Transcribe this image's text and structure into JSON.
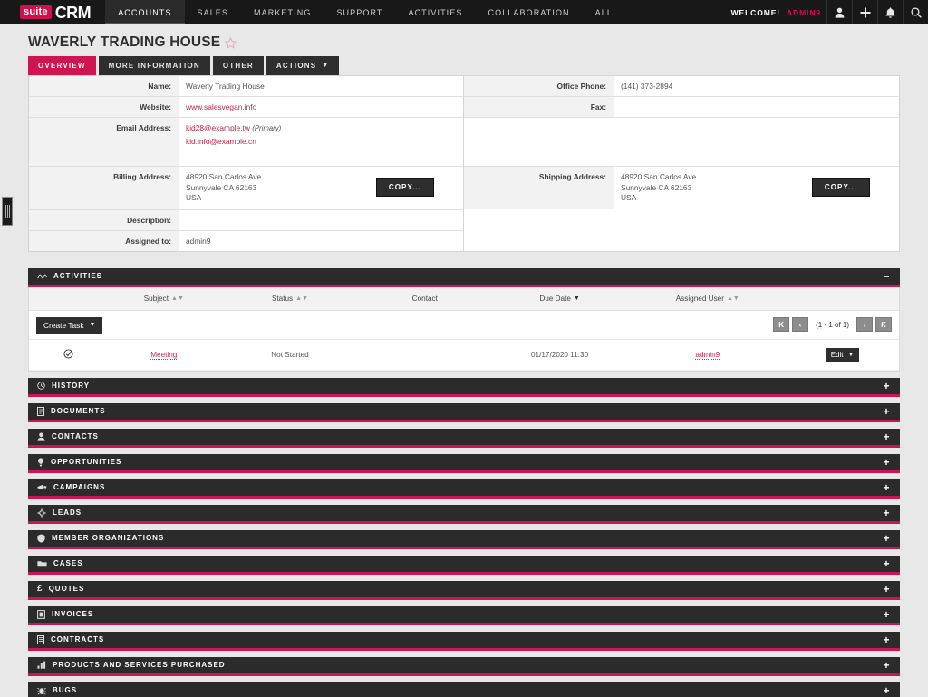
{
  "nav": {
    "logo_suite": "suite",
    "logo_crm": "CRM",
    "items": [
      {
        "label": "ACCOUNTS",
        "active": true
      },
      {
        "label": "SALES",
        "active": false
      },
      {
        "label": "MARKETING",
        "active": false
      },
      {
        "label": "SUPPORT",
        "active": false
      },
      {
        "label": "ACTIVITIES",
        "active": false
      },
      {
        "label": "COLLABORATION",
        "active": false
      },
      {
        "label": "ALL",
        "active": false
      }
    ],
    "welcome_label": "WELCOME!",
    "user_name": "ADMIN9",
    "icons": [
      "user-icon",
      "plus-icon",
      "bell-icon",
      "search-icon"
    ]
  },
  "page": {
    "title": "WAVERLY TRADING HOUSE",
    "favorite_icon": "star-icon"
  },
  "tabs": [
    {
      "label": "OVERVIEW",
      "active": true
    },
    {
      "label": "MORE INFORMATION",
      "active": false
    },
    {
      "label": "OTHER",
      "active": false
    },
    {
      "label": "ACTIONS",
      "active": false,
      "caret": true
    }
  ],
  "detail": {
    "left": [
      {
        "label": "Name:",
        "value": "Waverly Trading House"
      },
      {
        "label": "Website:",
        "value": "www.salesvegan.info",
        "link": true
      },
      {
        "label": "Email Address:",
        "emails": [
          {
            "address": "kid28@example.tw",
            "tag": "(Primary)"
          },
          {
            "address": "kid.info@example.cn",
            "tag": ""
          }
        ]
      },
      {
        "label": "Billing Address:",
        "address": [
          "48920 San Carlos Ave",
          "Sunnyvale CA   62163",
          "USA"
        ],
        "copy_label": "COPY..."
      },
      {
        "label": "Description:",
        "value": ""
      },
      {
        "label": "Assigned to:",
        "value": "admin9"
      }
    ],
    "right": [
      {
        "label": "Office Phone:",
        "value": "(141) 373-2894"
      },
      {
        "label": "Fax:",
        "value": ""
      },
      {
        "label": "",
        "value": ""
      },
      {
        "label": "Shipping Address:",
        "address": [
          "48920 San Carlos Ave",
          "Sunnyvale CA   62163",
          "USA"
        ],
        "copy_label": "COPY..."
      }
    ]
  },
  "activities": {
    "title": "ACTIVITIES",
    "icon": "pulse-icon",
    "toggle": "−",
    "columns": [
      {
        "label": "",
        "sort": false
      },
      {
        "label": "Subject",
        "sort": true,
        "active": false
      },
      {
        "label": "Status",
        "sort": true,
        "active": false
      },
      {
        "label": "Contact",
        "sort": false
      },
      {
        "label": "Due Date",
        "sort": true,
        "active": true
      },
      {
        "label": "Assigned User",
        "sort": true,
        "active": false
      },
      {
        "label": "",
        "sort": false
      }
    ],
    "create_label": "Create Task",
    "pagination": {
      "first": "K",
      "prev": "‹",
      "count": "(1 - 1 of 1)",
      "next": "›",
      "last": "Ƙ"
    },
    "rows": [
      {
        "row_icon": "task-check-icon",
        "subject": "Meeting",
        "status": "Not Started",
        "contact": "",
        "due_date": "01/17/2020 11:30",
        "assigned_user": "admin9",
        "edit_label": "Edit"
      }
    ]
  },
  "panels": [
    {
      "title": "HISTORY",
      "icon": "clock-icon",
      "toggle": "+"
    },
    {
      "title": "DOCUMENTS",
      "icon": "document-icon",
      "toggle": "+"
    },
    {
      "title": "CONTACTS",
      "icon": "person-icon",
      "toggle": "+"
    },
    {
      "title": "OPPORTUNITIES",
      "icon": "lightbulb-icon",
      "toggle": "+"
    },
    {
      "title": "CAMPAIGNS",
      "icon": "megaphone-icon",
      "toggle": "+"
    },
    {
      "title": "LEADS",
      "icon": "gear-icon",
      "toggle": "+"
    },
    {
      "title": "MEMBER ORGANIZATIONS",
      "icon": "shield-icon",
      "toggle": "+"
    },
    {
      "title": "CASES",
      "icon": "folder-icon",
      "toggle": "+"
    },
    {
      "title": "QUOTES",
      "icon": "pound-icon",
      "toggle": "+"
    },
    {
      "title": "INVOICES",
      "icon": "invoice-icon",
      "toggle": "+"
    },
    {
      "title": "CONTRACTS",
      "icon": "contract-icon",
      "toggle": "+"
    },
    {
      "title": "PRODUCTS AND SERVICES PURCHASED",
      "icon": "bar-chart-icon",
      "toggle": "+"
    },
    {
      "title": "BUGS",
      "icon": "bug-icon",
      "toggle": "+"
    }
  ],
  "colors": {
    "accent": "#cf1452",
    "nav_bg": "#181818",
    "panel_bg": "#2b2b2b",
    "link": "#b32a4a"
  }
}
